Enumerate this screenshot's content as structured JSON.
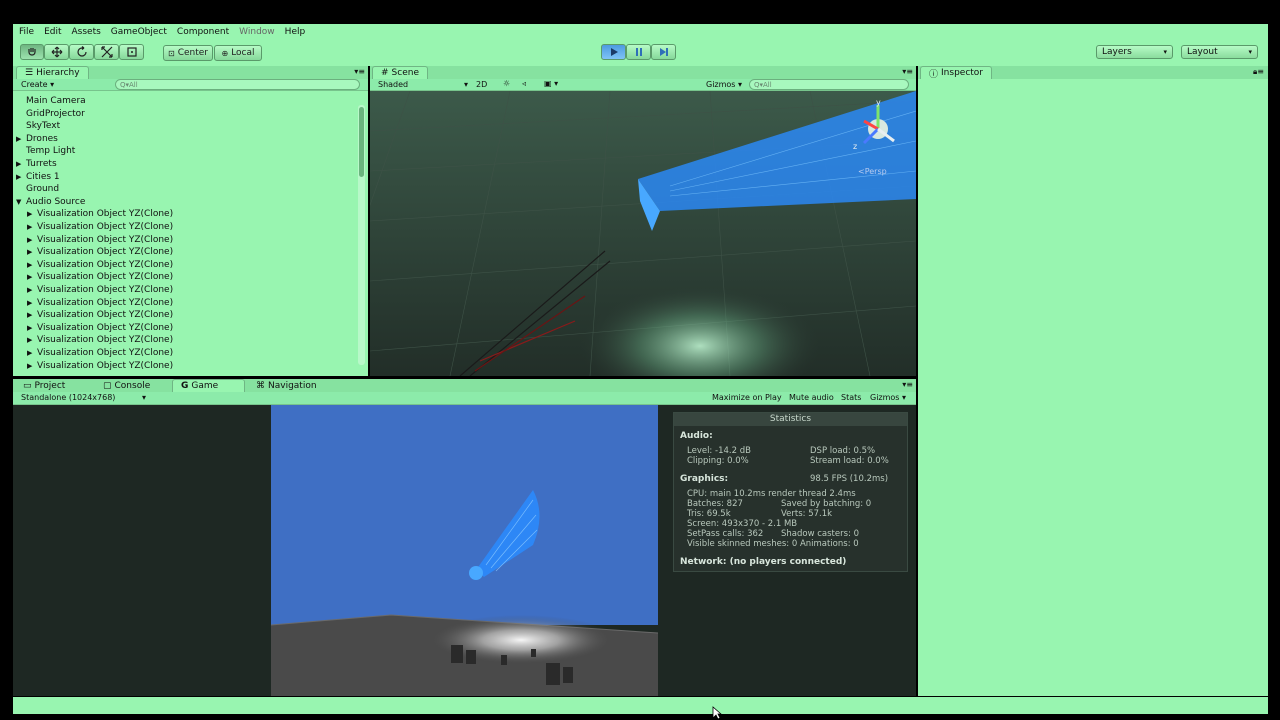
{
  "menu": [
    "File",
    "Edit",
    "Assets",
    "GameObject",
    "Component",
    "Window",
    "Help"
  ],
  "menu_disabled": [
    5
  ],
  "toolbar": {
    "pivot_label": "Center",
    "space_label": "Local",
    "layers_label": "Layers",
    "layout_label": "Layout"
  },
  "hierarchy": {
    "tab": "Hierarchy",
    "create_label": "Create",
    "search_placeholder": "Q▾All",
    "items": [
      {
        "label": "Main Camera",
        "indent": 0,
        "expander": ""
      },
      {
        "label": "GridProjector",
        "indent": 0,
        "expander": ""
      },
      {
        "label": "SkyText",
        "indent": 0,
        "expander": ""
      },
      {
        "label": "Drones",
        "indent": 0,
        "expander": "▶"
      },
      {
        "label": "Temp Light",
        "indent": 0,
        "expander": ""
      },
      {
        "label": "Turrets",
        "indent": 0,
        "expander": "▶"
      },
      {
        "label": "Cities 1",
        "indent": 0,
        "expander": "▶"
      },
      {
        "label": "Ground",
        "indent": 0,
        "expander": ""
      },
      {
        "label": "Audio Source",
        "indent": 0,
        "expander": "▼"
      },
      {
        "label": "Visualization Object YZ(Clone)",
        "indent": 1,
        "expander": "▶"
      },
      {
        "label": "Visualization Object YZ(Clone)",
        "indent": 1,
        "expander": "▶"
      },
      {
        "label": "Visualization Object YZ(Clone)",
        "indent": 1,
        "expander": "▶"
      },
      {
        "label": "Visualization Object YZ(Clone)",
        "indent": 1,
        "expander": "▶"
      },
      {
        "label": "Visualization Object YZ(Clone)",
        "indent": 1,
        "expander": "▶"
      },
      {
        "label": "Visualization Object YZ(Clone)",
        "indent": 1,
        "expander": "▶"
      },
      {
        "label": "Visualization Object YZ(Clone)",
        "indent": 1,
        "expander": "▶"
      },
      {
        "label": "Visualization Object YZ(Clone)",
        "indent": 1,
        "expander": "▶"
      },
      {
        "label": "Visualization Object YZ(Clone)",
        "indent": 1,
        "expander": "▶"
      },
      {
        "label": "Visualization Object YZ(Clone)",
        "indent": 1,
        "expander": "▶"
      },
      {
        "label": "Visualization Object YZ(Clone)",
        "indent": 1,
        "expander": "▶"
      },
      {
        "label": "Visualization Object YZ(Clone)",
        "indent": 1,
        "expander": "▶"
      },
      {
        "label": "Visualization Object YZ(Clone)",
        "indent": 1,
        "expander": "▶"
      }
    ]
  },
  "scene": {
    "tab": "Scene",
    "shading": "Shaded",
    "mode_2d": "2D",
    "gizmos": "Gizmos",
    "search_placeholder": "Q▾All",
    "persp": "<Persp",
    "axis_y": "y",
    "axis_z": "z"
  },
  "inspector": {
    "tab": "Inspector"
  },
  "bottom_tabs": {
    "project": "Project",
    "console": "Console",
    "game": "Game",
    "navigation": "Navigation"
  },
  "game": {
    "resolution": "Standalone (1024x768)",
    "maximize": "Maximize on Play",
    "mute": "Mute audio",
    "stats": "Stats",
    "gizmos": "Gizmos"
  },
  "statistics": {
    "title": "Statistics",
    "audio_header": "Audio:",
    "level": "Level: -14.2 dB",
    "clipping": "Clipping: 0.0%",
    "dsp_load": "DSP load: 0.5%",
    "stream_load": "Stream load: 0.0%",
    "graphics_header": "Graphics:",
    "fps": "98.5 FPS (10.2ms)",
    "cpu": "CPU: main 10.2ms  render thread 2.4ms",
    "batches": "Batches: 827",
    "saved_batching": "Saved by batching: 0",
    "tris": "Tris: 69.5k",
    "verts": "Verts: 57.1k",
    "screen": "Screen: 493x370 - 2.1 MB",
    "setpass": "SetPass calls: 362",
    "shadow_casters": "Shadow casters: 0",
    "skinned": "Visible skinned meshes: 0  Animations: 0",
    "network": "Network: (no players connected)"
  },
  "colors": {
    "panel": "#98f5b0",
    "scene_bg": "#2c3a33",
    "game_sky": "#3f6fc4",
    "viz_blue": "#2a8cff"
  }
}
